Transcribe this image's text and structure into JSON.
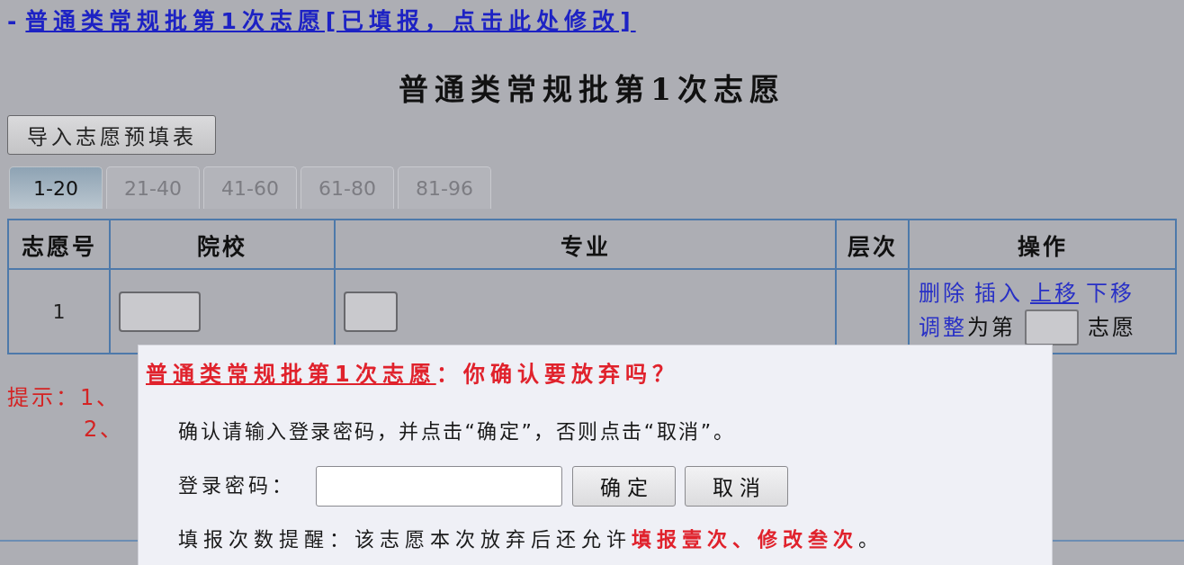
{
  "header": {
    "marker": "-",
    "link": "普通类常规批第1次志愿[已填报，点击此处修改]"
  },
  "page_title": "普通类常规批第1次志愿",
  "import_button": "导入志愿预填表",
  "tabs": [
    {
      "label": "1-20",
      "selected": true
    },
    {
      "label": "21-40",
      "selected": false
    },
    {
      "label": "41-60",
      "selected": false
    },
    {
      "label": "61-80",
      "selected": false
    },
    {
      "label": "81-96",
      "selected": false
    }
  ],
  "table": {
    "columns": [
      "志愿号",
      "院校",
      "专业",
      "层次",
      "操作"
    ],
    "rows": [
      {
        "number": "1",
        "actions": [
          {
            "label": "删除",
            "hovered": false
          },
          {
            "label": "插入",
            "hovered": false
          },
          {
            "label": "上移",
            "hovered": true
          },
          {
            "label": "下移",
            "hovered": false
          }
        ],
        "adjust": {
          "link": "调整",
          "label": "为第",
          "suffix": "志愿"
        }
      }
    ]
  },
  "hints": [
    "提示：1、",
    "2、"
  ],
  "dialog": {
    "title_link": "普通类常规批第1次志愿",
    "title_text": "：你确认要放弃吗？",
    "message": "确认请输入登录密码，并点击“确定”，否则点击“取消”。",
    "password_label": "登录密码：",
    "buttons": [
      "确 定",
      "取 消"
    ],
    "reminder": "填报次数提醒：该志愿本次放弃后还允许**填报壹次、修改叁次**。"
  }
}
